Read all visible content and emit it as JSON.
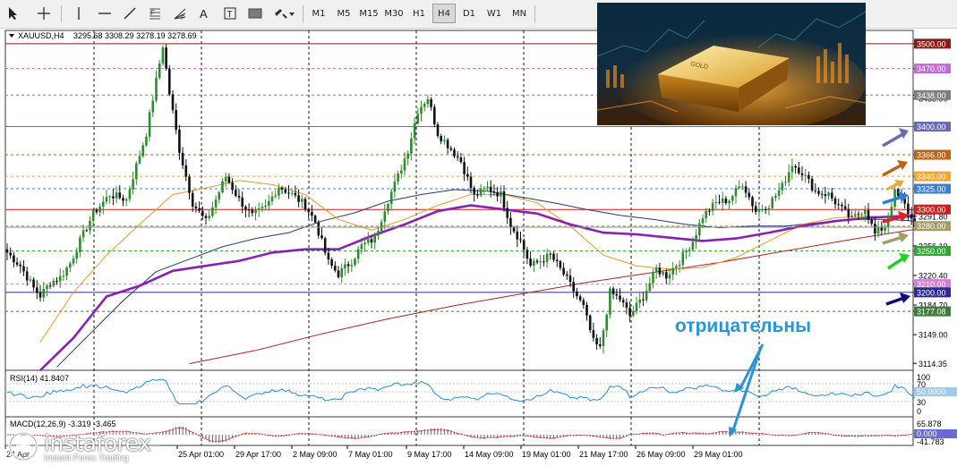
{
  "toolbar": {
    "timeframes": [
      "M1",
      "M5",
      "M15",
      "M30",
      "H1",
      "H4",
      "D1",
      "W1",
      "MN"
    ],
    "active_timeframe": "H4",
    "tool_icons": [
      "cursor-icon",
      "crosshair-icon",
      "vertical-line-icon",
      "horizontal-line-icon",
      "trendline-icon",
      "fibonacci-icon",
      "fibo-fan-icon",
      "text-icon",
      "label-icon",
      "rectangle-icon",
      "shapes-dropdown-icon"
    ]
  },
  "header": {
    "symbol": "XAUUSD,H4",
    "ohlc": "3295.68 3308.29 3278.19 3278.69"
  },
  "colors": {
    "bull": "#2e8b2e",
    "bear": "#111111",
    "ma_thick": "#8a1fb5",
    "ma_orange": "#e69a28",
    "ma_navy": "#243a7a",
    "ma_red": "#b22222",
    "annotation": "#2a94d6"
  },
  "price_axis": {
    "tick_labels": [
      "3500.00",
      "3470.00",
      "3438.00",
      "3433.90",
      "3400.00",
      "3366.00",
      "3340.00",
      "3325.00",
      "3300.00",
      "3291.80",
      "3280.00",
      "3256.10",
      "3250.00",
      "3220.40",
      "3210.00",
      "3200.00",
      "3184.70",
      "3177.08",
      "3149.00",
      "3114.35"
    ],
    "level_tags": [
      {
        "price": "3500.00",
        "bg": "#8b1a1a",
        "fg": "#ffffff"
      },
      {
        "price": "3470.00",
        "bg": "#c06bd6",
        "fg": "#ffffff"
      },
      {
        "price": "3438.00",
        "bg": "#7f7f7f",
        "fg": "#ffffff"
      },
      {
        "price": "3400.00",
        "bg": "#6b6bb5",
        "fg": "#ffffff"
      },
      {
        "price": "3366.00",
        "bg": "#b8651a",
        "fg": "#ffffff"
      },
      {
        "price": "3340.00",
        "bg": "#f0a830",
        "fg": "#ffffff"
      },
      {
        "price": "3325.00",
        "bg": "#3b7fd1",
        "fg": "#ffffff"
      },
      {
        "price": "3300.00",
        "bg": "#cc1f1f",
        "fg": "#ffffff"
      },
      {
        "price": "3280.00",
        "bg": "#a39c6a",
        "fg": "#ffffff"
      },
      {
        "price": "3250.00",
        "bg": "#2ea82e",
        "fg": "#ffffff"
      },
      {
        "price": "3210.00",
        "bg": "#d47fd4",
        "fg": "#ffffff"
      },
      {
        "price": "3200.00",
        "bg": "#2b2b8f",
        "fg": "#ffffff"
      },
      {
        "price": "3177.08",
        "bg": "#3d7a3d",
        "fg": "#ffffff"
      }
    ]
  },
  "time_axis": [
    "24 Apr",
    "25 Apr 01:00",
    "29 Apr 17:00",
    "2 May 09:00",
    "7 May 01:00",
    "9 May 17:00",
    "14 May 09:00",
    "19 May 01:00",
    "21 May 17:00",
    "26 May 09:00",
    "29 May 01:00"
  ],
  "rsi": {
    "label": "RSI(14) 41.8407",
    "levels": [
      "100",
      "70",
      "50.0000",
      "30",
      "0"
    ]
  },
  "macd": {
    "label": "MACD(12,26,9) -3.319 -3.465",
    "levels": [
      "65.878",
      "0.000",
      "-41.783"
    ]
  },
  "annotation_text": "отрицательны",
  "watermark": {
    "brand": "instaforex",
    "tagline": "Instant Forex Trading"
  },
  "chart_data": {
    "type": "candlestick",
    "symbol": "XAUUSD",
    "timeframe": "H4",
    "ylim": [
      3106,
      3516
    ],
    "horizontal_levels": [
      3500,
      3470,
      3438,
      3400,
      3366,
      3340,
      3325,
      3300,
      3280,
      3250,
      3210,
      3200,
      3177.08
    ],
    "last_close": 3278.69,
    "price_series": [
      [
        0,
        3248
      ],
      [
        4,
        3232
      ],
      [
        8,
        3205
      ],
      [
        10,
        3196
      ],
      [
        13,
        3212
      ],
      [
        16,
        3218
      ],
      [
        19,
        3235
      ],
      [
        22,
        3262
      ],
      [
        26,
        3295
      ],
      [
        31,
        3318
      ],
      [
        36,
        3312
      ],
      [
        38,
        3340
      ],
      [
        42,
        3392
      ],
      [
        45,
        3455
      ],
      [
        47,
        3498
      ],
      [
        49,
        3440
      ],
      [
        52,
        3372
      ],
      [
        56,
        3308
      ],
      [
        60,
        3285
      ],
      [
        63,
        3312
      ],
      [
        66,
        3340
      ],
      [
        70,
        3312
      ],
      [
        74,
        3292
      ],
      [
        78,
        3302
      ],
      [
        82,
        3328
      ],
      [
        86,
        3318
      ],
      [
        90,
        3305
      ],
      [
        93,
        3285
      ],
      [
        97,
        3236
      ],
      [
        100,
        3222
      ],
      [
        104,
        3238
      ],
      [
        107,
        3256
      ],
      [
        111,
        3265
      ],
      [
        114,
        3302
      ],
      [
        118,
        3340
      ],
      [
        121,
        3372
      ],
      [
        124,
        3420
      ],
      [
        127,
        3435
      ],
      [
        130,
        3392
      ],
      [
        133,
        3378
      ],
      [
        137,
        3358
      ],
      [
        141,
        3316
      ],
      [
        145,
        3326
      ],
      [
        149,
        3318
      ],
      [
        152,
        3282
      ],
      [
        155,
        3262
      ],
      [
        158,
        3232
      ],
      [
        161,
        3238
      ],
      [
        164,
        3245
      ],
      [
        168,
        3222
      ],
      [
        171,
        3202
      ],
      [
        174,
        3182
      ],
      [
        177,
        3140
      ],
      [
        179,
        3132
      ],
      [
        182,
        3200
      ],
      [
        185,
        3192
      ],
      [
        188,
        3172
      ],
      [
        192,
        3195
      ],
      [
        196,
        3228
      ],
      [
        199,
        3220
      ],
      [
        203,
        3238
      ],
      [
        207,
        3262
      ],
      [
        210,
        3292
      ],
      [
        214,
        3308
      ],
      [
        218,
        3312
      ],
      [
        222,
        3332
      ],
      [
        226,
        3298
      ],
      [
        230,
        3306
      ],
      [
        234,
        3328
      ],
      [
        237,
        3355
      ],
      [
        240,
        3345
      ],
      [
        244,
        3322
      ],
      [
        248,
        3318
      ],
      [
        252,
        3300
      ],
      [
        255,
        3288
      ],
      [
        259,
        3302
      ],
      [
        262,
        3270
      ],
      [
        265,
        3280
      ],
      [
        268,
        3320
      ],
      [
        271,
        3305
      ],
      [
        274,
        3280
      ]
    ],
    "moving_averages": [
      {
        "color": "thick purple",
        "points": [
          [
            10,
            3105
          ],
          [
            20,
            3145
          ],
          [
            30,
            3195
          ],
          [
            40,
            3208
          ],
          [
            50,
            3226
          ],
          [
            60,
            3232
          ],
          [
            70,
            3238
          ],
          [
            80,
            3248
          ],
          [
            90,
            3252
          ],
          [
            100,
            3252
          ],
          [
            110,
            3268
          ],
          [
            120,
            3282
          ],
          [
            130,
            3298
          ],
          [
            140,
            3305
          ],
          [
            150,
            3300
          ],
          [
            160,
            3295
          ],
          [
            170,
            3282
          ],
          [
            180,
            3272
          ],
          [
            190,
            3270
          ],
          [
            200,
            3266
          ],
          [
            210,
            3262
          ],
          [
            220,
            3265
          ],
          [
            230,
            3272
          ],
          [
            240,
            3280
          ],
          [
            250,
            3286
          ],
          [
            260,
            3290
          ],
          [
            270,
            3292
          ],
          [
            274,
            3292
          ]
        ]
      },
      {
        "color": "orange",
        "points": [
          [
            10,
            3140
          ],
          [
            20,
            3200
          ],
          [
            30,
            3245
          ],
          [
            40,
            3282
          ],
          [
            50,
            3318
          ],
          [
            60,
            3326
          ],
          [
            70,
            3335
          ],
          [
            80,
            3330
          ],
          [
            90,
            3318
          ],
          [
            100,
            3288
          ],
          [
            110,
            3275
          ],
          [
            120,
            3288
          ],
          [
            130,
            3305
          ],
          [
            140,
            3318
          ],
          [
            150,
            3318
          ],
          [
            160,
            3308
          ],
          [
            170,
            3280
          ],
          [
            180,
            3245
          ],
          [
            190,
            3232
          ],
          [
            200,
            3228
          ],
          [
            210,
            3230
          ],
          [
            220,
            3242
          ],
          [
            230,
            3262
          ],
          [
            240,
            3282
          ],
          [
            250,
            3290
          ],
          [
            260,
            3292
          ],
          [
            274,
            3290
          ]
        ]
      },
      {
        "color": "navy",
        "points": [
          [
            15,
            3110
          ],
          [
            25,
            3150
          ],
          [
            35,
            3190
          ],
          [
            45,
            3225
          ],
          [
            55,
            3240
          ],
          [
            65,
            3255
          ],
          [
            75,
            3265
          ],
          [
            85,
            3272
          ],
          [
            95,
            3286
          ],
          [
            105,
            3296
          ],
          [
            115,
            3310
          ],
          [
            125,
            3318
          ],
          [
            135,
            3324
          ],
          [
            145,
            3322
          ],
          [
            155,
            3315
          ],
          [
            165,
            3308
          ],
          [
            175,
            3300
          ],
          [
            185,
            3293
          ],
          [
            195,
            3288
          ],
          [
            205,
            3282
          ],
          [
            215,
            3278
          ],
          [
            225,
            3280
          ],
          [
            235,
            3280
          ],
          [
            245,
            3284
          ],
          [
            255,
            3288
          ],
          [
            265,
            3288
          ],
          [
            274,
            3286
          ]
        ]
      },
      {
        "color": "red",
        "points": [
          [
            55,
            3114
          ],
          [
            75,
            3130
          ],
          [
            95,
            3150
          ],
          [
            115,
            3168
          ],
          [
            135,
            3184
          ],
          [
            155,
            3198
          ],
          [
            175,
            3212
          ],
          [
            195,
            3224
          ],
          [
            215,
            3236
          ],
          [
            235,
            3250
          ],
          [
            255,
            3264
          ],
          [
            274,
            3276
          ]
        ]
      }
    ]
  }
}
